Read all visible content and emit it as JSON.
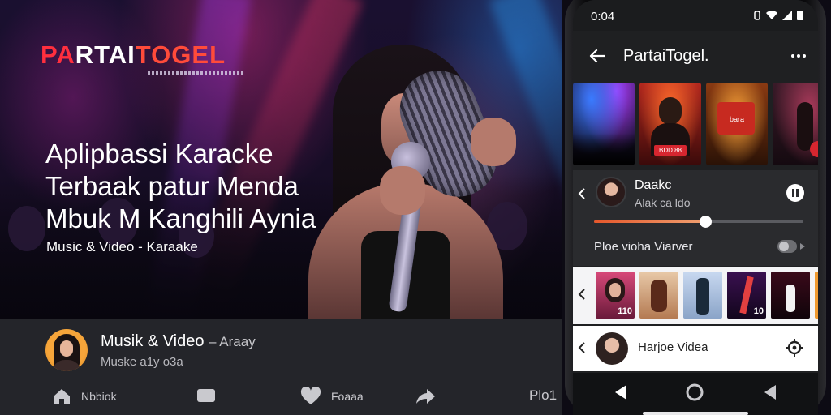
{
  "brand": {
    "logo_part1": "PA",
    "logo_part2": "RTAI",
    "logo_part3": "TOGEL"
  },
  "hero": {
    "headline_line1": "Aplipbassi Karacke",
    "headline_line2": "Terbaak patur Menda",
    "headline_line3": "Mbuk  M  Kanghili Aynia",
    "subline": "Music & Video - Karaake"
  },
  "channel": {
    "title": "Musik & Video",
    "title_suffix": "– Araay",
    "subtitle": "Muske a1y o3a"
  },
  "bottom_nav": {
    "item1": "Nbbiok",
    "item3": "Foaaa",
    "item5": "Plo1"
  },
  "phone": {
    "status_time": "0:04",
    "app_title": "PartaiTogel.",
    "thumb_tag_1": "BDD 88",
    "thumb_tag_3": "bara",
    "now_playing_name": "Daakc",
    "now_playing_sub": "Alak ca ldo",
    "playback_progress": 0.53,
    "row_label": "Ploe vioha Viarver",
    "shelf_nums": [
      "110",
      "",
      "",
      "10",
      ""
    ],
    "video_row_label": "Harjoe Videa"
  },
  "colors": {
    "accent": "#ff2f3e",
    "progress": "#e5572b",
    "panel": "#24252a"
  }
}
